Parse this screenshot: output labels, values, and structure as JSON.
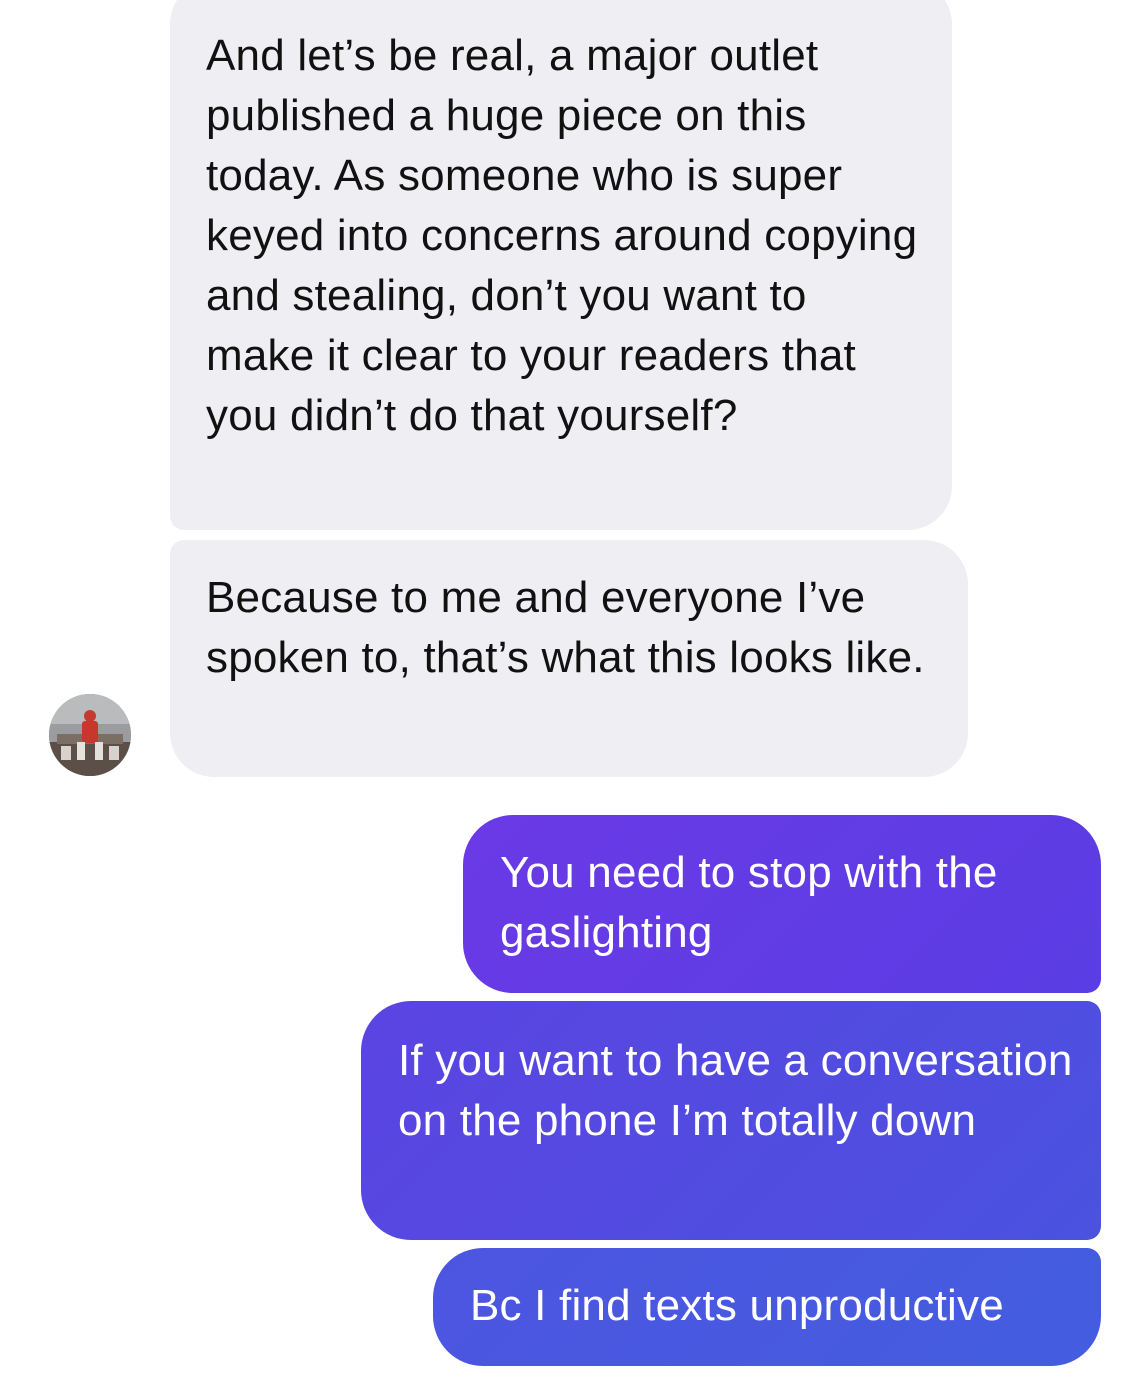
{
  "conversation": {
    "incoming": [
      {
        "text": "And let’s be real, a major outlet published a huge piece on this today. As someone who is super keyed into concerns around copying and stealing, don’t you want to make it clear to your readers that you didn’t do that yourself?"
      },
      {
        "text": "Because to me and everyone I’ve spoken to, that’s what this looks like."
      }
    ],
    "outgoing": [
      {
        "text": "You need to stop with the gaslighting"
      },
      {
        "text": "If you want to have a conversation on the phone I’m totally down"
      },
      {
        "text": "Bc I find texts unproductive"
      }
    ]
  },
  "avatar": {
    "icon": "contact-avatar-icon"
  },
  "colors": {
    "incoming_bubble": "#efeef3",
    "incoming_text": "#111111",
    "outgoing_gradient_start": "#6a3ae6",
    "outgoing_gradient_end": "#435de0",
    "outgoing_text": "#ffffff",
    "background": "#ffffff"
  }
}
